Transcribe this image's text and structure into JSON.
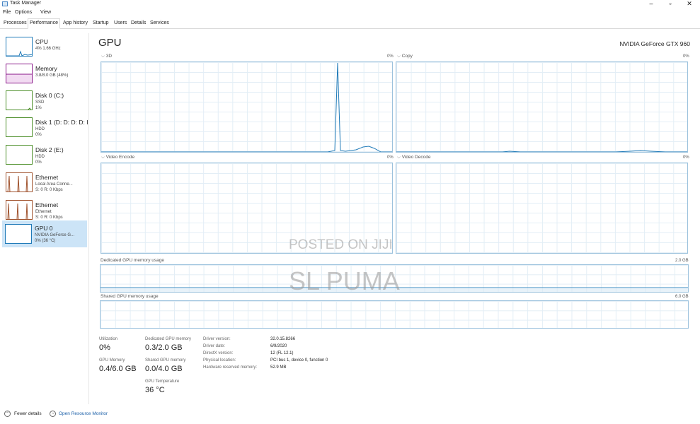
{
  "window": {
    "title": "Task Manager",
    "minimize": "–",
    "maximize": "▫",
    "close": "✕"
  },
  "menu": [
    "File",
    "Options",
    "View"
  ],
  "tabs": [
    "Processes",
    "Performance",
    "App history",
    "Startup",
    "Users",
    "Details",
    "Services"
  ],
  "active_tab": "Performance",
  "sidebar": [
    {
      "title": "CPU",
      "sub1": "4% 1.66 GHz",
      "sub2": "",
      "sub3": "",
      "color": "#1f7ab8"
    },
    {
      "title": "Memory",
      "sub1": "3.8/8.0 GB (48%)",
      "sub2": "",
      "sub3": "",
      "color": "#8b1a8b"
    },
    {
      "title": "Disk 0 (C:)",
      "sub1": "SSD",
      "sub2": "1%",
      "sub3": "",
      "color": "#4d8f2a"
    },
    {
      "title": "Disk 1 (D: D: D: D: I",
      "sub1": "HDD",
      "sub2": "0%",
      "sub3": "",
      "color": "#4d8f2a"
    },
    {
      "title": "Disk 2 (E:)",
      "sub1": "HDD",
      "sub2": "0%",
      "sub3": "",
      "color": "#4d8f2a"
    },
    {
      "title": "Ethernet",
      "sub1": "Local Area Conne...",
      "sub2": "S: 0 R: 0 Kbps",
      "sub3": "",
      "color": "#a0522d"
    },
    {
      "title": "Ethernet",
      "sub1": "Ethernet",
      "sub2": "S: 0 R: 0 Kbps",
      "sub3": "",
      "color": "#a0522d"
    },
    {
      "title": "GPU 0",
      "sub1": "NVIDIA GeForce G...",
      "sub2": "0% (36 °C)",
      "sub3": "",
      "color": "#1f7ab8"
    }
  ],
  "main": {
    "title": "GPU",
    "model": "NVIDIA GeForce GTX 960",
    "graphs": {
      "g3d": {
        "label": "3D",
        "pct": "0%"
      },
      "copy": {
        "label": "Copy",
        "pct": "0%"
      },
      "encode": {
        "label": "Video Encode",
        "pct": "0%"
      },
      "decode": {
        "label": "Video Decode",
        "pct": "0%"
      },
      "dedicated": {
        "label": "Dedicated GPU memory usage",
        "max": "2.0 GB"
      },
      "shared": {
        "label": "Shared GPU memory usage",
        "max": "6.0 GB"
      }
    },
    "stats": {
      "utilization_label": "Utilization",
      "utilization_value": "0%",
      "dedicated_label": "Dedicated GPU memory",
      "dedicated_value": "0.3/2.0 GB",
      "gpu_memory_label": "GPU Memory",
      "gpu_memory_value": "0.4/6.0 GB",
      "shared_label": "Shared GPU memory",
      "shared_value": "0.0/4.0 GB",
      "temp_label": "GPU Temperature",
      "temp_value": "36 °C"
    },
    "properties": [
      {
        "label": "Driver version:",
        "value": "32.0.15.8266"
      },
      {
        "label": "Driver date:",
        "value": "6/9/2020"
      },
      {
        "label": "DirectX version:",
        "value": "12 (FL 12.1)"
      },
      {
        "label": "Physical location:",
        "value": "PCI bus 1, device 0, function 0"
      },
      {
        "label": "Hardware reserved memory:",
        "value": "52.9 MB"
      }
    ]
  },
  "watermark": {
    "line1": "POSTED ON JIJI",
    "line2": "SL PUMA"
  },
  "footer": {
    "fewer_details": "Fewer details",
    "open_monitor": "Open Resource Monitor"
  },
  "colors": {
    "accent": "#1f7ab8",
    "graph_border": "#9cc2dd",
    "graph_grid": "#e3eef6",
    "selected_bg": "#cce4f7",
    "link": "#1a5fa8"
  }
}
